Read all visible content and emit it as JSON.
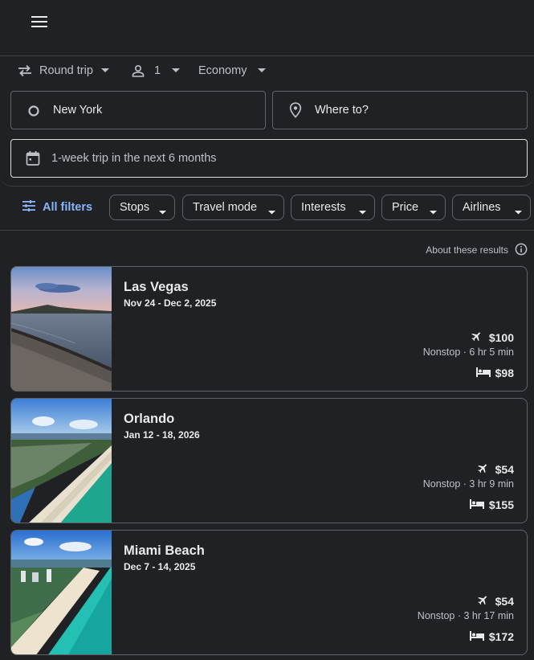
{
  "options": {
    "trip_type": "Round trip",
    "passengers": "1",
    "cabin": "Economy"
  },
  "search": {
    "origin": "New York",
    "destination_placeholder": "Where to?",
    "dates": "1-week trip in the next 6 months"
  },
  "filters": {
    "all_filters": "All filters",
    "chips": [
      "Stops",
      "Travel mode",
      "Interests",
      "Price",
      "Airlines"
    ]
  },
  "about_results": "About these results",
  "results": [
    {
      "name": "Las Vegas",
      "dates": "Nov 24 - Dec 2, 2025",
      "flight_price": "$100",
      "flight_detail": "Nonstop · 6 hr 5 min",
      "hotel_price": "$98"
    },
    {
      "name": "Orlando",
      "dates": "Jan 12 - 18, 2026",
      "flight_price": "$54",
      "flight_detail": "Nonstop · 3 hr 9 min",
      "hotel_price": "$155"
    },
    {
      "name": "Miami Beach",
      "dates": "Dec 7 - 14, 2025",
      "flight_price": "$54",
      "flight_detail": "Nonstop · 3 hr 17 min",
      "hotel_price": "$172"
    }
  ],
  "colors": {
    "background": "#202124",
    "accent": "#8ab4f8",
    "border": "#5f6368",
    "text": "#e8eaed"
  }
}
